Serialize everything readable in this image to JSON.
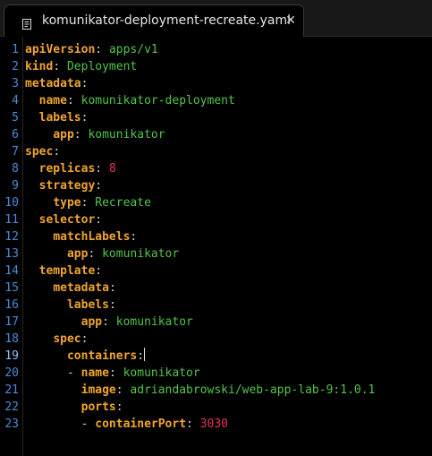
{
  "tab": {
    "title": "komunikator-deployment-recreate.yaml",
    "icon": "text-file-icon",
    "close_icon": "close-icon"
  },
  "editor": {
    "active_line": 19,
    "lines": [
      {
        "number": "1",
        "indent": "",
        "key": "apiVersion",
        "colon": ":",
        "value": "apps/v1",
        "value_type": "string"
      },
      {
        "number": "2",
        "indent": "",
        "key": "kind",
        "colon": ":",
        "value": "Deployment",
        "value_type": "string"
      },
      {
        "number": "3",
        "indent": "",
        "key": "metadata",
        "colon": ":",
        "value": "",
        "value_type": "none"
      },
      {
        "number": "4",
        "indent": "  ",
        "key": "name",
        "colon": ":",
        "value": "komunikator-deployment",
        "value_type": "string"
      },
      {
        "number": "5",
        "indent": "  ",
        "key": "labels",
        "colon": ":",
        "value": "",
        "value_type": "none"
      },
      {
        "number": "6",
        "indent": "    ",
        "key": "app",
        "colon": ":",
        "value": "komunikator",
        "value_type": "string"
      },
      {
        "number": "7",
        "indent": "",
        "key": "spec",
        "colon": ":",
        "value": "",
        "value_type": "none"
      },
      {
        "number": "8",
        "indent": "  ",
        "key": "replicas",
        "colon": ":",
        "value": "8",
        "value_type": "number"
      },
      {
        "number": "9",
        "indent": "  ",
        "key": "strategy",
        "colon": ":",
        "value": "",
        "value_type": "none"
      },
      {
        "number": "10",
        "indent": "    ",
        "key": "type",
        "colon": ":",
        "value": "Recreate",
        "value_type": "string"
      },
      {
        "number": "11",
        "indent": "  ",
        "key": "selector",
        "colon": ":",
        "value": "",
        "value_type": "none"
      },
      {
        "number": "12",
        "indent": "    ",
        "key": "matchLabels",
        "colon": ":",
        "value": "",
        "value_type": "none"
      },
      {
        "number": "13",
        "indent": "      ",
        "key": "app",
        "colon": ":",
        "value": "komunikator",
        "value_type": "string"
      },
      {
        "number": "14",
        "indent": "  ",
        "key": "template",
        "colon": ":",
        "value": "",
        "value_type": "none"
      },
      {
        "number": "15",
        "indent": "    ",
        "key": "metadata",
        "colon": ":",
        "value": "",
        "value_type": "none"
      },
      {
        "number": "16",
        "indent": "      ",
        "key": "labels",
        "colon": ":",
        "value": "",
        "value_type": "none"
      },
      {
        "number": "17",
        "indent": "        ",
        "key": "app",
        "colon": ":",
        "value": "komunikator",
        "value_type": "string"
      },
      {
        "number": "18",
        "indent": "    ",
        "key": "spec",
        "colon": ":",
        "value": "",
        "value_type": "none"
      },
      {
        "number": "19",
        "indent": "      ",
        "key": "containers",
        "colon": ":",
        "value": "",
        "value_type": "none"
      },
      {
        "number": "20",
        "indent": "      - ",
        "key": "name",
        "colon": ":",
        "value": "komunikator",
        "value_type": "string"
      },
      {
        "number": "21",
        "indent": "        ",
        "key": "image",
        "colon": ":",
        "value": "adriandabrowski/web-app-lab-9:1.0.1",
        "value_type": "string"
      },
      {
        "number": "22",
        "indent": "        ",
        "key": "ports",
        "colon": ":",
        "value": "",
        "value_type": "none"
      },
      {
        "number": "23",
        "indent": "        - ",
        "key": "containerPort",
        "colon": ":",
        "value": "3030",
        "value_type": "number"
      }
    ]
  },
  "colors": {
    "key": "#f0a531",
    "string": "#52c44a",
    "number": "#e8315a",
    "line_number": "#4a8bd8",
    "background": "#000000"
  }
}
